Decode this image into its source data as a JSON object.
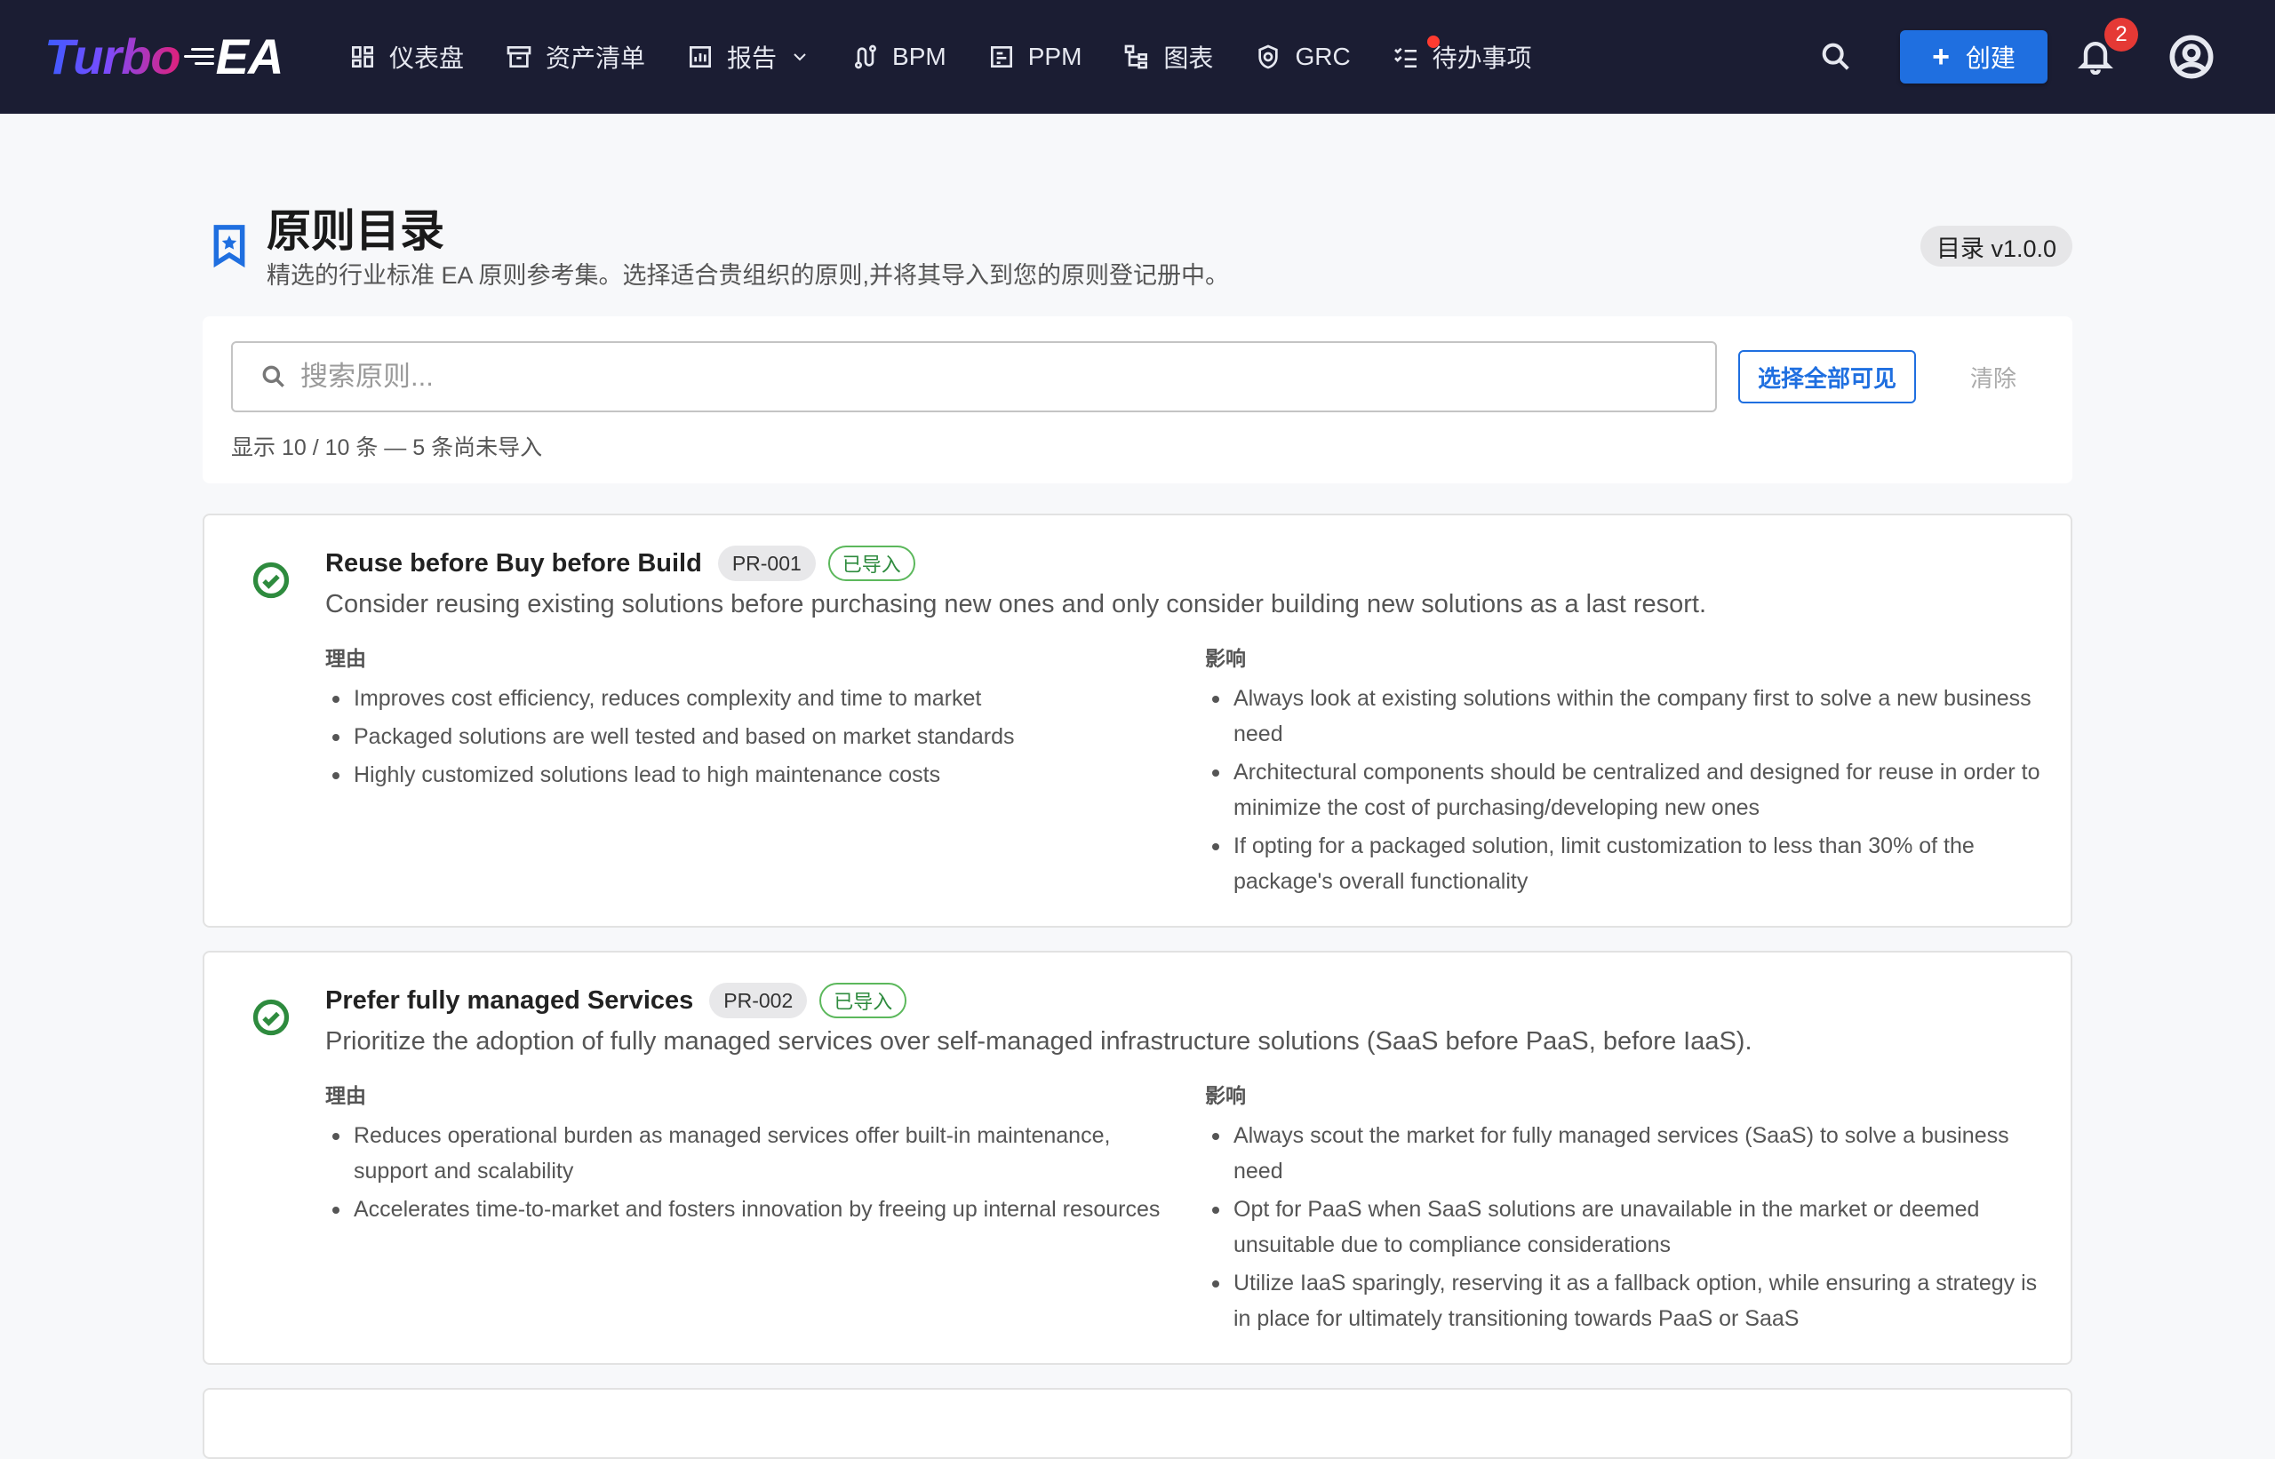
{
  "app": {
    "brand_turbo": "Turbo",
    "brand_ea": "EA"
  },
  "nav": {
    "items": [
      {
        "label": "仪表盘",
        "icon": "dashboard-icon"
      },
      {
        "label": "资产清单",
        "icon": "archive-icon"
      },
      {
        "label": "报告",
        "icon": "report-chart-icon",
        "has_dropdown": true
      },
      {
        "label": "BPM",
        "icon": "route-icon"
      },
      {
        "label": "PPM",
        "icon": "project-board-icon"
      },
      {
        "label": "图表",
        "icon": "diagram-tree-icon"
      },
      {
        "label": "GRC",
        "icon": "shield-check-icon"
      },
      {
        "label": "待办事项",
        "icon": "checklist-icon",
        "has_dot": true
      }
    ],
    "create_label": "创建",
    "notifications_count": "2"
  },
  "header": {
    "title": "原则目录",
    "subtitle": "精选的行业标准 EA 原则参考集。选择适合贵组织的原则,并将其导入到您的原则登记册中。",
    "version": "目录 v1.0.0"
  },
  "search": {
    "placeholder": "搜索原则...",
    "value": "",
    "select_all_label": "选择全部可见",
    "clear_label": "清除",
    "count_text": "显示 10 / 10 条 — 5 条尚未导入"
  },
  "labels": {
    "rationale": "理由",
    "implications": "影响",
    "imported": "已导入"
  },
  "principles": [
    {
      "title": "Reuse before Buy before Build",
      "id": "PR-001",
      "description": "Consider reusing existing solutions before purchasing new ones and only consider building new solutions as a last resort.",
      "rationale": [
        "Improves cost efficiency, reduces complexity and time to market",
        "Packaged solutions are well tested and based on market standards",
        "Highly customized solutions lead to high maintenance costs"
      ],
      "implications": [
        "Always look at existing solutions within the company first to solve a new business need",
        "Architectural components should be centralized and designed for reuse in order to minimize the cost of purchasing/developing new ones",
        "If opting for a packaged solution, limit customization to less than 30% of the package's overall functionality"
      ]
    },
    {
      "title": "Prefer fully managed Services",
      "id": "PR-002",
      "description": "Prioritize the adoption of fully managed services over self-managed infrastructure solutions (SaaS before PaaS, before IaaS).",
      "rationale": [
        "Reduces operational burden as managed services offer built-in maintenance, support and scalability",
        "Accelerates time-to-market and fosters innovation by freeing up internal resources"
      ],
      "implications": [
        "Always scout the market for fully managed services (SaaS) to solve a business need",
        "Opt for PaaS when SaaS solutions are unavailable in the market or deemed unsuitable due to compliance considerations",
        "Utilize IaaS sparingly, reserving it as a fallback option, while ensuring a strategy is in place for ultimately transitioning towards PaaS or SaaS"
      ]
    }
  ]
}
